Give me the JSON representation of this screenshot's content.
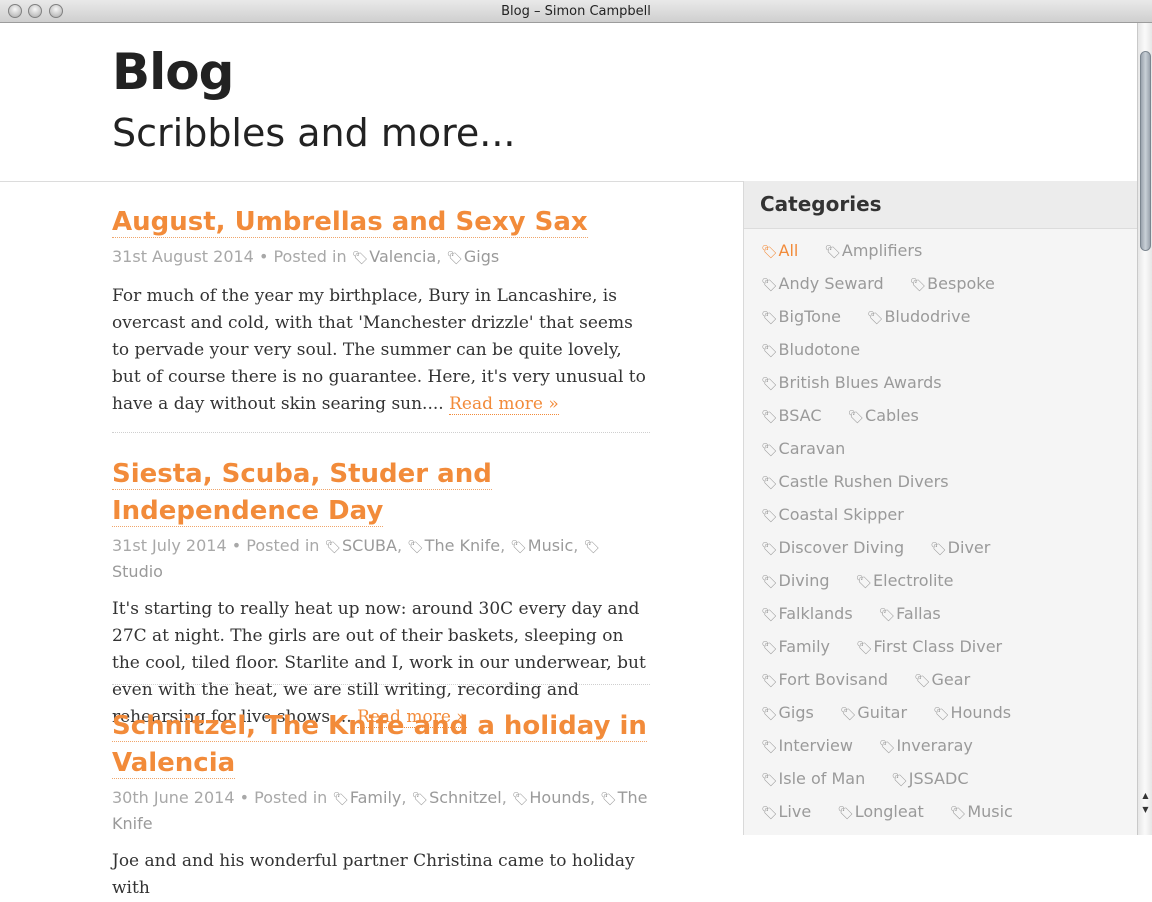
{
  "window": {
    "title": "Blog – Simon Campbell"
  },
  "header": {
    "title": "Blog",
    "subtitle": "Scribbles and more..."
  },
  "posts": [
    {
      "title": "August, Umbrellas and Sexy Sax",
      "date": "31st August 2014",
      "posted_in": "Posted in",
      "tags": [
        "Valencia",
        "Gigs"
      ],
      "excerpt": "For much of the year my birthplace, Bury in Lancashire, is overcast and cold, with that 'Manchester drizzle' that seems to pervade your very soul. The summer can be quite lovely, but of course there is no guarantee. Here, it's very unusual to have a day without skin searing sun....",
      "read_more": "Read more »"
    },
    {
      "title": "Siesta, Scuba, Studer and Independence Day",
      "date": "31st July 2014",
      "posted_in": "Posted in",
      "tags": [
        "SCUBA",
        "The Knife",
        "Music",
        "Studio"
      ],
      "excerpt": "It's starting to really heat up now: around 30C every day and 27C at night. The girls are out of their baskets, sleeping on the cool, tiled floor. Starlite and I, work in our underwear, but even with the heat, we are still writing, recording and rehearsing for live shows....",
      "read_more": "Read more »"
    },
    {
      "title": "Schnitzel, The Knife and a holiday in Valencia",
      "date": "30th June 2014",
      "posted_in": "Posted in",
      "tags": [
        "Family",
        "Schnitzel",
        "Hounds",
        "The Knife"
      ],
      "excerpt": "Joe and and his wonderful partner Christina came to holiday with"
    }
  ],
  "sidebar": {
    "heading": "Categories",
    "rows": [
      [
        "All",
        "Amplifiers"
      ],
      [
        "Andy Seward",
        "Bespoke"
      ],
      [
        "BigTone",
        "Bludodrive"
      ],
      [
        "Bludotone"
      ],
      [
        "British Blues Awards"
      ],
      [
        "BSAC",
        "Cables"
      ],
      [
        "Caravan"
      ],
      [
        "Castle Rushen Divers"
      ],
      [
        "Coastal Skipper"
      ],
      [
        "Discover Diving",
        "Diver"
      ],
      [
        "Diving",
        "Electrolite"
      ],
      [
        "Falklands",
        "Fallas"
      ],
      [
        "Family",
        "First Class Diver"
      ],
      [
        "Fort Bovisand",
        "Gear"
      ],
      [
        "Gigs",
        "Guitar",
        "Hounds"
      ],
      [
        "Interview",
        "Inveraray"
      ],
      [
        "Isle of Man",
        "JSSADC"
      ],
      [
        "Live",
        "Longleat",
        "Music"
      ]
    ],
    "active": "All"
  },
  "colors": {
    "accent": "#f28b3a",
    "meta": "#a8a8a8",
    "sidebar_bg": "#f5f5f5"
  },
  "icons": {
    "tag": "tag-icon"
  }
}
